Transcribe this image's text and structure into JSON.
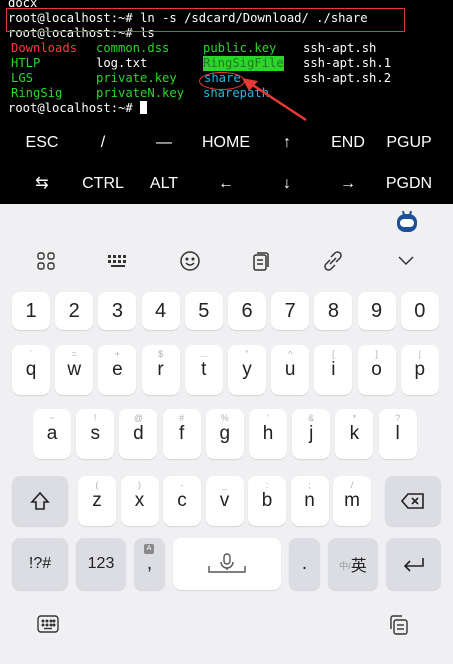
{
  "terminal": {
    "line_docx": "docx",
    "cmd1": "root@localhost:~# ln -s /sdcard/Download/ ./share",
    "cmd2": "root@localhost:~# ls",
    "prompt": "root@localhost:~# ",
    "files": [
      [
        "Downloads",
        "common.dss",
        "public.key",
        "ssh-apt.sh"
      ],
      [
        "HTLP",
        "log.txt",
        "RingSigFile",
        "ssh-apt.sh.1"
      ],
      [
        "LGS",
        "private.key",
        "share",
        "ssh-apt.sh.2"
      ],
      [
        "RingSig",
        "privateN.key",
        "sharepath",
        ""
      ]
    ]
  },
  "extra_keys": {
    "row1": [
      "ESC",
      "/",
      "—",
      "HOME",
      "↑",
      "END",
      "PGUP"
    ],
    "row2": [
      "⇆",
      "CTRL",
      "ALT",
      "←",
      "↓",
      "→",
      "PGDN"
    ]
  },
  "keyboard": {
    "numbers": [
      "1",
      "2",
      "3",
      "4",
      "5",
      "6",
      "7",
      "8",
      "9",
      "0"
    ],
    "row_q": [
      [
        "q",
        "`"
      ],
      [
        "w",
        "="
      ],
      [
        "e",
        "+"
      ],
      [
        "r",
        "$"
      ],
      [
        "t",
        "..."
      ],
      [
        "y",
        "\""
      ],
      [
        "u",
        "^"
      ],
      [
        "i",
        "["
      ],
      [
        "o",
        "]"
      ],
      [
        "p",
        "|"
      ]
    ],
    "row_a": [
      [
        "a",
        "~"
      ],
      [
        "s",
        "!"
      ],
      [
        "d",
        "@"
      ],
      [
        "f",
        "#"
      ],
      [
        "g",
        "%"
      ],
      [
        "h",
        "'"
      ],
      [
        "j",
        "&"
      ],
      [
        "k",
        "*"
      ],
      [
        "l",
        "?"
      ]
    ],
    "row_z": [
      [
        "z",
        "("
      ],
      [
        "x",
        ")"
      ],
      [
        "c",
        "-"
      ],
      [
        "v",
        "_"
      ],
      [
        "b",
        ":"
      ],
      [
        "n",
        ";"
      ],
      [
        "m",
        "/"
      ]
    ],
    "sym_label": "!?#",
    "num_label": "123",
    "comma": ",",
    "period": ".",
    "lang_small": "中/",
    "lang_big": "英"
  },
  "icons": {
    "toolbar": [
      "grid-icon",
      "keyboard-layout-icon",
      "emoji-icon",
      "clipboard-icon",
      "link-icon",
      "chevron-down-icon"
    ],
    "bottom": [
      "keyboard-icon",
      "copy-icon"
    ]
  }
}
